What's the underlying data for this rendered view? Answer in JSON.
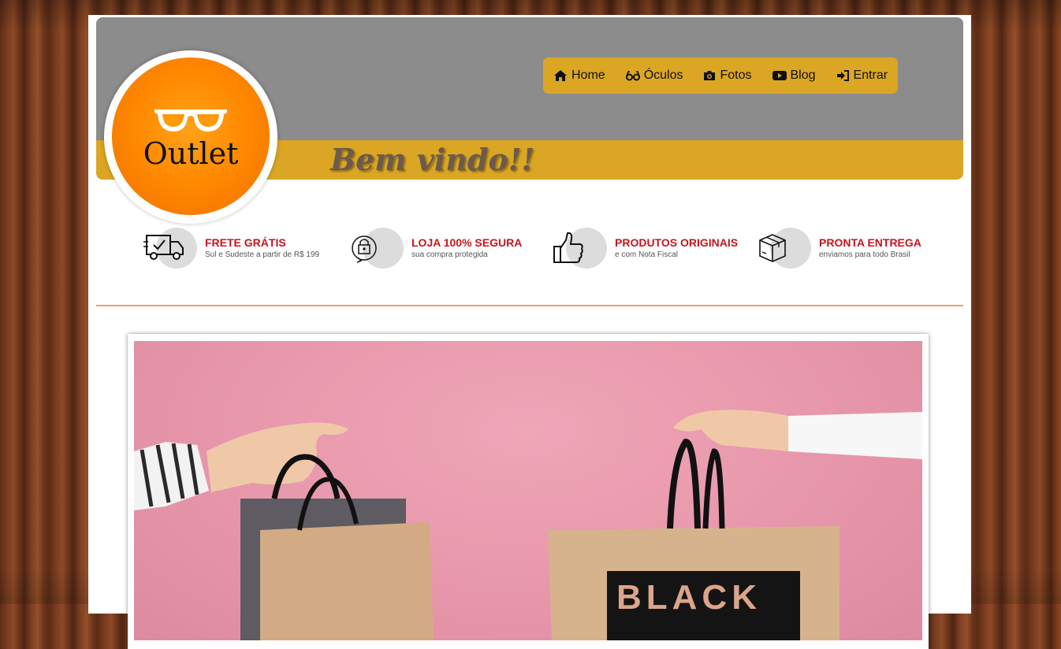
{
  "brand": {
    "logo_text": "Outlet",
    "welcome": "Bem vindo!!"
  },
  "nav": [
    {
      "label": "Home",
      "icon": "home-icon"
    },
    {
      "label": "Óculos",
      "icon": "glasses-icon"
    },
    {
      "label": "Fotos",
      "icon": "camera-icon"
    },
    {
      "label": "Blog",
      "icon": "youtube-icon"
    },
    {
      "label": "Entrar",
      "icon": "sign-in-icon"
    }
  ],
  "features": [
    {
      "title": "FRETE GRÁTIS",
      "subtitle": "Sul e Sudeste a partir de R$ 199",
      "icon": "truck-icon"
    },
    {
      "title": "LOJA 100% SEGURA",
      "subtitle": "sua compra protegida",
      "icon": "lock-icon"
    },
    {
      "title": "PRODUTOS ORIGINAIS",
      "subtitle": "e com Nota Fiscal",
      "icon": "thumbs-up-icon"
    },
    {
      "title": "PRONTA ENTREGA",
      "subtitle": "enviamos para todo Brasil",
      "icon": "box-icon"
    }
  ],
  "banner": {
    "bag_text": "BLACK"
  },
  "colors": {
    "header_gray": "#8c8c8c",
    "accent_gold": "#dba623",
    "logo_orange": "#ff8a00",
    "feature_red": "#c8141c",
    "divider": "#f59a6e",
    "photo_pink": "#e898ac"
  }
}
